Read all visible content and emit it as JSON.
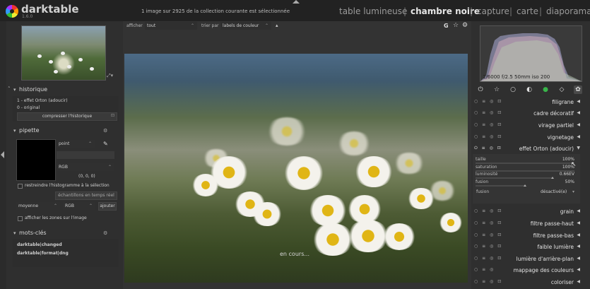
{
  "app": {
    "name": "darktable",
    "version": "1.6.0"
  },
  "header": {
    "collection_status": "1 image sur 2925 de la collection courante est sélectionnée",
    "views": [
      "table lumineuse",
      "chambre noire",
      "capture",
      "carte",
      "diaporama"
    ],
    "active_view": "chambre noire",
    "separator": "|"
  },
  "toolbar": {
    "show_label": "afficher",
    "show_value": "tout",
    "sort_label": "trier par",
    "sort_value": "labels de couleur",
    "sort_direction_icon": "up-arrow-icon",
    "right_letter": "G"
  },
  "left": {
    "history": {
      "title": "historique",
      "items": [
        "1 - effet Orton (adoucir)",
        "0 - original"
      ],
      "compress_label": "compresser l'historique"
    },
    "picker": {
      "title": "pipette",
      "mode_value": "point",
      "model_value": "RGB",
      "readout": "(0, 0, 0)",
      "restrict_label": "restreindre l'histogramme à la sélection",
      "live_samples_label": "échantillons en temps réel",
      "stat_value": "moyenne",
      "color_model_value": "RGB",
      "add_label": "ajouter",
      "show_areas_label": "afficher les zones sur l'image"
    },
    "keywords": {
      "title": "mots-clés",
      "items": [
        "darktable|changed",
        "darktable|format|dng"
      ]
    }
  },
  "center": {
    "working_label": "en cours..."
  },
  "right": {
    "exif": "1/6000 f/2.5 50mm iso 200",
    "group_icons": [
      "power-icon",
      "star-icon",
      "circle-icon",
      "half-circle-icon",
      "color-circle-icon",
      "tag-icon",
      "effects-icon"
    ],
    "modules_top": [
      "filigrane",
      "cadre décoratif",
      "virage partiel",
      "vignetage"
    ],
    "expanded_module": {
      "name": "effet Orton (adoucir)",
      "sliders": [
        {
          "label": "taille",
          "value": "100%",
          "level": 1.0
        },
        {
          "label": "saturation",
          "value": "100%",
          "level": 1.0
        },
        {
          "label": "luminosité",
          "value": "0.66EV",
          "level": 0.78
        },
        {
          "label": "fusion",
          "value": "50%",
          "level": 0.5
        }
      ],
      "blend_label": "fusion",
      "blend_value": "désactivé(e)"
    },
    "modules_bottom": [
      "grain",
      "filtre passe-haut",
      "filtre passe-bas",
      "faible lumière",
      "lumière d'arrière-plan",
      "mappage des couleurs",
      "coloriser"
    ]
  }
}
